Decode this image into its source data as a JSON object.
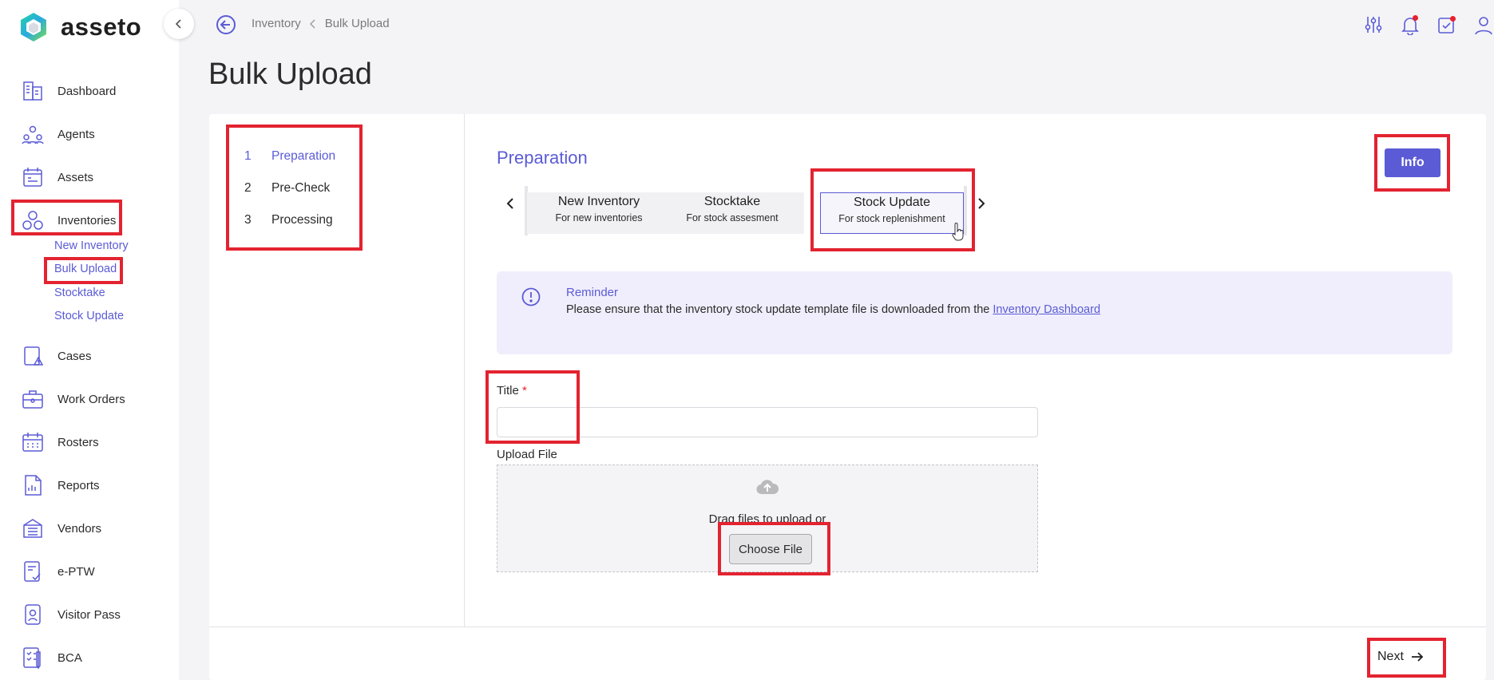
{
  "app": {
    "name": "asseto"
  },
  "breadcrumb": {
    "parent": "Inventory",
    "current": "Bulk Upload"
  },
  "page": {
    "title": "Bulk Upload"
  },
  "sidebar": {
    "items": [
      {
        "label": "Dashboard",
        "icon": "building-icon"
      },
      {
        "label": "Agents",
        "icon": "agents-icon"
      },
      {
        "label": "Assets",
        "icon": "assets-icon"
      },
      {
        "label": "Inventories",
        "icon": "inventories-icon"
      },
      {
        "label": "Cases",
        "icon": "cases-icon"
      },
      {
        "label": "Work Orders",
        "icon": "briefcase-icon"
      },
      {
        "label": "Rosters",
        "icon": "calendar-icon"
      },
      {
        "label": "Reports",
        "icon": "report-icon"
      },
      {
        "label": "Vendors",
        "icon": "vendor-icon"
      },
      {
        "label": "e-PTW",
        "icon": "permit-icon"
      },
      {
        "label": "Visitor Pass",
        "icon": "badge-icon"
      },
      {
        "label": "BCA",
        "icon": "checklist-icon"
      }
    ],
    "sub_items": [
      "New Inventory",
      "Bulk Upload",
      "Stocktake",
      "Stock Update"
    ]
  },
  "steps": [
    {
      "num": "1",
      "label": "Preparation"
    },
    {
      "num": "2",
      "label": "Pre-Check"
    },
    {
      "num": "3",
      "label": "Processing"
    }
  ],
  "section": {
    "title": "Preparation",
    "info_label": "Info"
  },
  "tabs": [
    {
      "title": "New Inventory",
      "subtitle": "For new inventories"
    },
    {
      "title": "Stocktake",
      "subtitle": "For stock assesment"
    },
    {
      "title": "Stock Update",
      "subtitle": "For stock replenishment"
    }
  ],
  "reminder": {
    "title": "Reminder",
    "text": "Please ensure that the inventory stock update template file is downloaded from the ",
    "link": "Inventory Dashboard"
  },
  "form": {
    "title_label": "Title",
    "required_mark": "*",
    "title_value": "",
    "upload_label": "Upload File",
    "drag_text": "Drag files to upload or",
    "choose_label": "Choose File"
  },
  "footer": {
    "next_label": "Next"
  },
  "colors": {
    "accent": "#5b5bd6",
    "highlight": "#e32330"
  }
}
